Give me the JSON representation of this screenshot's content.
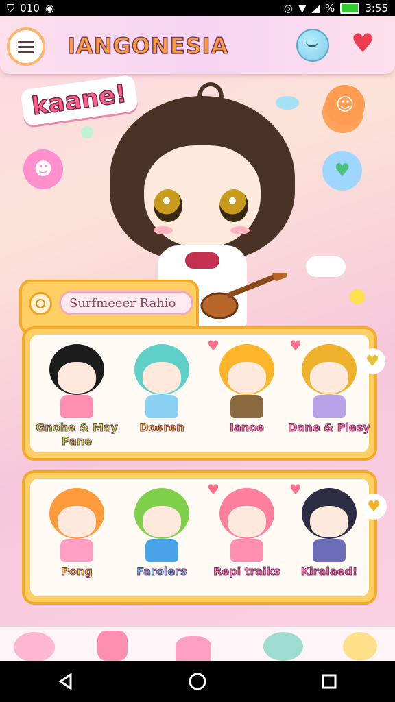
{
  "status_bar": {
    "left_text": "010",
    "battery_text": "%",
    "time": "3:55",
    "icons": [
      "vpn-key-icon",
      "settings-circle-icon",
      "hotspot-icon",
      "wifi-icon",
      "signal-icon",
      "battery-icon"
    ]
  },
  "app": {
    "title": "IANGONESIA",
    "hero_badge": "kaane!",
    "search": {
      "placeholder": "Surfmeeer Rahio"
    },
    "row1": [
      {
        "label": "Gnohe & May Pane",
        "hair": "#1c1c1c",
        "outfit": "#ff8fb0",
        "style": "green"
      },
      {
        "label": "Doeren",
        "hair": "#5fd0c7",
        "outfit": "#8ad0f2",
        "style": "yellow"
      },
      {
        "label": "Ianoe",
        "hair": "#ffb52a",
        "outfit": "#8a6a3e",
        "style": "pink"
      },
      {
        "label": "Dane & Plesy",
        "hair": "#f0b22c",
        "outfit": "#b8a2e8",
        "style": "pink"
      }
    ],
    "row2": [
      {
        "label": "Pong",
        "hair": "#ff9a3d",
        "outfit": "#ff9fc2",
        "style": "yellow"
      },
      {
        "label": "Farolers",
        "hair": "#7fd14b",
        "outfit": "#4aa2e8",
        "style": "blue"
      },
      {
        "label": "Repi traiks",
        "hair": "#ff7f9f",
        "outfit": "#ff8fb0",
        "style": "pink"
      },
      {
        "label": "Kiralaed!",
        "hair": "#2c2c44",
        "outfit": "#6c6cb8",
        "style": "pink"
      }
    ]
  },
  "nav_bar": {
    "back": "◁",
    "home": "○",
    "recents": "□"
  },
  "colors": {
    "accent_orange": "#f6a827",
    "accent_pink": "#ff5c8a",
    "heart_red": "#ef3b4f"
  }
}
